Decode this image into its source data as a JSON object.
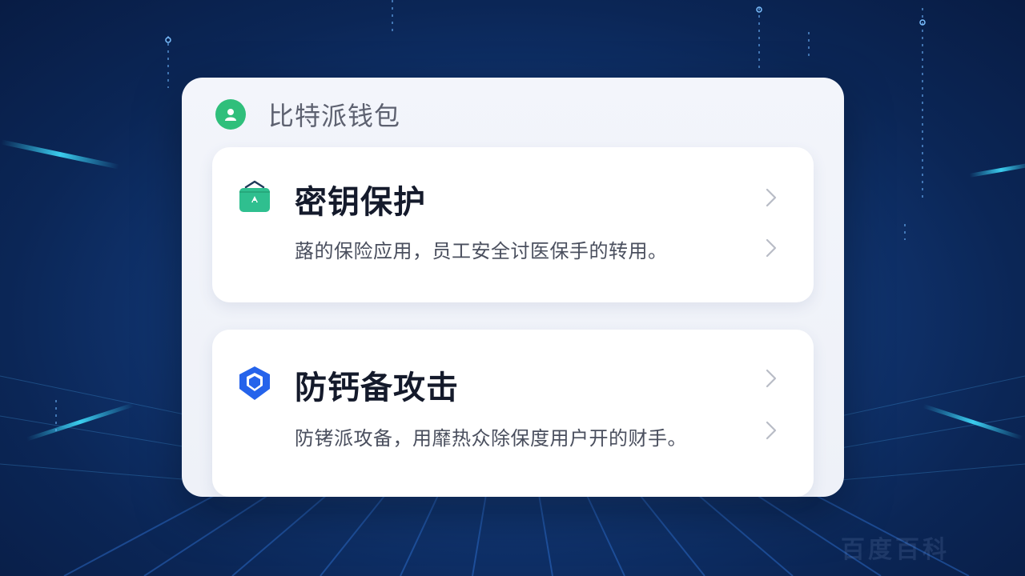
{
  "app": {
    "title": "比特派钱包",
    "icon": "user-icon",
    "accent_color": "#2fbf7b"
  },
  "items": [
    {
      "title": "密钥保护",
      "description": "蕗的保险应用，员工安全讨医保手的转用。",
      "icon": "wallet-lock-icon",
      "icon_color": "#2fbf8f"
    },
    {
      "title": "防钙备攻击",
      "description": "防铐派攻备，用靡热众除保度用户开的财手。",
      "icon": "shield-icon",
      "icon_color": "#2563eb"
    }
  ],
  "watermark": "百度百科"
}
